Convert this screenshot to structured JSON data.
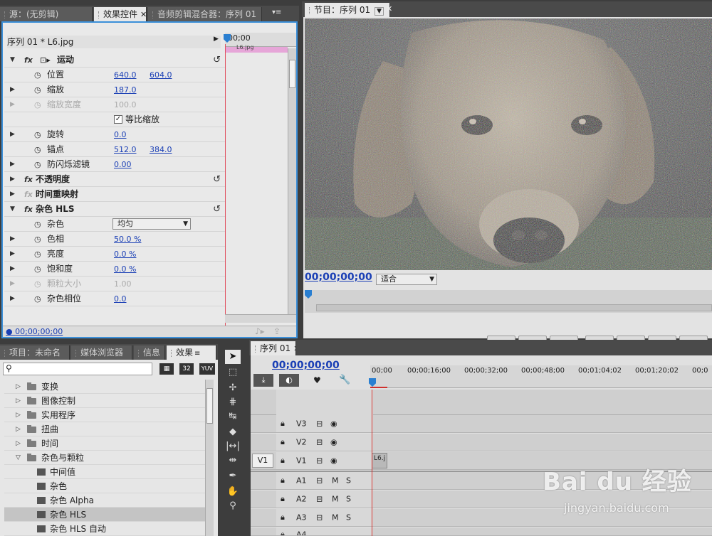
{
  "source_panel": {
    "tabs": [
      {
        "label": "源：(无剪辑)"
      },
      {
        "label": "效果控件"
      },
      {
        "label": "音频剪辑混合器：序列 01"
      }
    ]
  },
  "effect_controls": {
    "clip_label": "序列 01 * L6.jpg",
    "ruler_time": "00;00",
    "clip_bar": "L6.jpg",
    "rows": [
      {
        "type": "effect",
        "label": "运动",
        "fx": "fx"
      },
      {
        "type": "prop",
        "label": "位置",
        "v1": "640.0",
        "v2": "604.0"
      },
      {
        "type": "prop",
        "label": "缩放",
        "v1": "187.0"
      },
      {
        "type": "prop",
        "label": "缩放宽度",
        "v1": "100.0",
        "dim": true
      },
      {
        "type": "check",
        "label": "等比缩放"
      },
      {
        "type": "prop",
        "label": "旋转",
        "v1": "0.0"
      },
      {
        "type": "prop",
        "label": "锚点",
        "v1": "512.0",
        "v2": "384.0"
      },
      {
        "type": "prop",
        "label": "防闪烁滤镜",
        "v1": "0.00"
      },
      {
        "type": "effect",
        "label": "不透明度",
        "fx": "fx"
      },
      {
        "type": "effect",
        "label": "时间重映射",
        "fx": "fx"
      },
      {
        "type": "effect",
        "label": "杂色 HLS",
        "fx": "fx"
      },
      {
        "type": "select",
        "label": "杂色",
        "v1": "均匀"
      },
      {
        "type": "prop",
        "label": "色相",
        "v1": "50.0 %"
      },
      {
        "type": "prop",
        "label": "亮度",
        "v1": "0.0 %"
      },
      {
        "type": "prop",
        "label": "饱和度",
        "v1": "0.0 %"
      },
      {
        "type": "prop",
        "label": "颗粒大小",
        "v1": "1.00",
        "dim": true
      },
      {
        "type": "prop",
        "label": "杂色相位",
        "v1": "0.0"
      }
    ],
    "timecode": "00;00;00;00"
  },
  "program": {
    "tab": "节目：序列 01",
    "timecode": "00;00;00;00",
    "fit": "适合",
    "buttons": [
      "marker-button",
      "mark-in-button",
      "mark-out-button",
      "go-to-in-button",
      "step-back-button",
      "play-button",
      "step-forward-button"
    ]
  },
  "project_panel": {
    "tabs": [
      {
        "label": "项目：未命名"
      },
      {
        "label": "媒体浏览器"
      },
      {
        "label": "信息"
      },
      {
        "label": "效果"
      }
    ],
    "search_placeholder": "",
    "badges": [
      "32",
      "YUV"
    ],
    "tree": [
      {
        "label": "变换",
        "kind": "folder",
        "open": false
      },
      {
        "label": "图像控制",
        "kind": "folder",
        "open": false
      },
      {
        "label": "实用程序",
        "kind": "folder",
        "open": false
      },
      {
        "label": "扭曲",
        "kind": "folder",
        "open": false
      },
      {
        "label": "时间",
        "kind": "folder",
        "open": false
      },
      {
        "label": "杂色与颗粒",
        "kind": "folder",
        "open": true
      },
      {
        "label": "中间值",
        "kind": "effect"
      },
      {
        "label": "杂色",
        "kind": "effect"
      },
      {
        "label": "杂色 Alpha",
        "kind": "effect"
      },
      {
        "label": "杂色 HLS",
        "kind": "effect",
        "selected": true
      },
      {
        "label": "杂色 HLS 自动",
        "kind": "effect"
      }
    ]
  },
  "timeline": {
    "tab": "序列 01",
    "timecode": "00;00;00;00",
    "ruler": [
      "00;00",
      "00;00;16;00",
      "00;00;32;00",
      "00;00;48;00",
      "00;01;04;02",
      "00;01;20;02",
      "00;0"
    ],
    "video_tracks": [
      {
        "name": "V3"
      },
      {
        "name": "V2"
      },
      {
        "name": "V1",
        "src": "V1",
        "clip": "L6.j"
      }
    ],
    "audio_tracks": [
      {
        "name": "A1"
      },
      {
        "name": "A2"
      },
      {
        "name": "A3"
      },
      {
        "name": "A4"
      }
    ],
    "mute": "M",
    "solo": "S"
  },
  "watermark": {
    "text": "Bai du 经验",
    "url": "jingyan.baidu.com"
  }
}
